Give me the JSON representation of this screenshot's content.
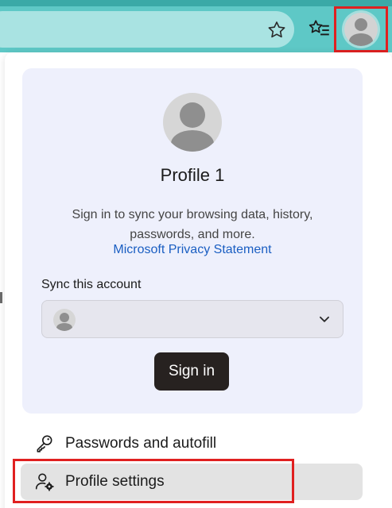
{
  "toolbar": {
    "star_icon": "star-outline-icon",
    "favorites_icon": "favorites-list-icon",
    "profile_icon": "profile-avatar-icon"
  },
  "flyout": {
    "profile_name": "Profile 1",
    "sync_description": "Sign in to sync your browsing data, history, passwords, and more.",
    "privacy_link": "Microsoft Privacy Statement",
    "sync_label": "Sync this account",
    "sign_in_button": "Sign in",
    "menu": [
      {
        "label": "Passwords and autofill",
        "icon": "key-icon"
      },
      {
        "label": "Profile settings",
        "icon": "profile-settings-icon"
      }
    ]
  },
  "colors": {
    "toolbar": "#5ec8c6",
    "card": "#eef0fc",
    "link": "#1a5ec2",
    "button": "#272220",
    "highlight": "#e02020"
  }
}
